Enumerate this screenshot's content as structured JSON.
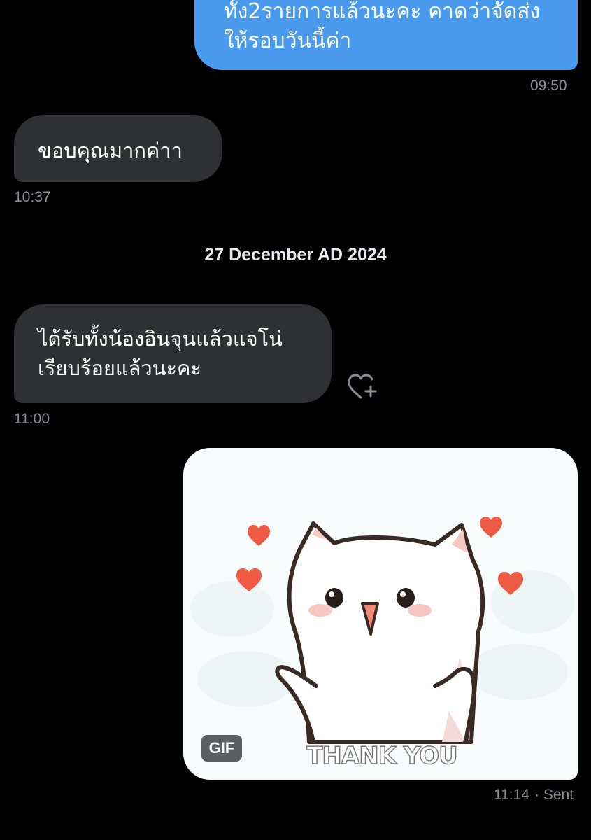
{
  "messages": {
    "out_1": {
      "lines": [
        "ทั้ง2รายการแล้วนะคะ คาดว่าจัดส่ง",
        "ให้รอบวันนี้ค่า"
      ],
      "time": "09:50"
    },
    "in_1": {
      "text": "ขอบคุณมากค่าา",
      "time": "10:37"
    },
    "date_separator": "27 December AD 2024",
    "in_2": {
      "lines": [
        "ได้รับทั้งน้องอินจุนแล้วแจโน่",
        "เรียบร้อยแล้วนะคะ"
      ],
      "time": "11:00",
      "reaction_icon": "heart-plus-icon"
    },
    "out_gif": {
      "badge": "GIF",
      "caption": "THANK YOU",
      "time": "11:14",
      "status": "· Sent"
    }
  },
  "colors": {
    "background": "#000000",
    "outgoing_bubble": "#4a9aed",
    "incoming_bubble": "#2f3033",
    "timestamp": "#8a8d91",
    "date_separator": "#e7e9ea",
    "heart": "#ef5a45"
  }
}
